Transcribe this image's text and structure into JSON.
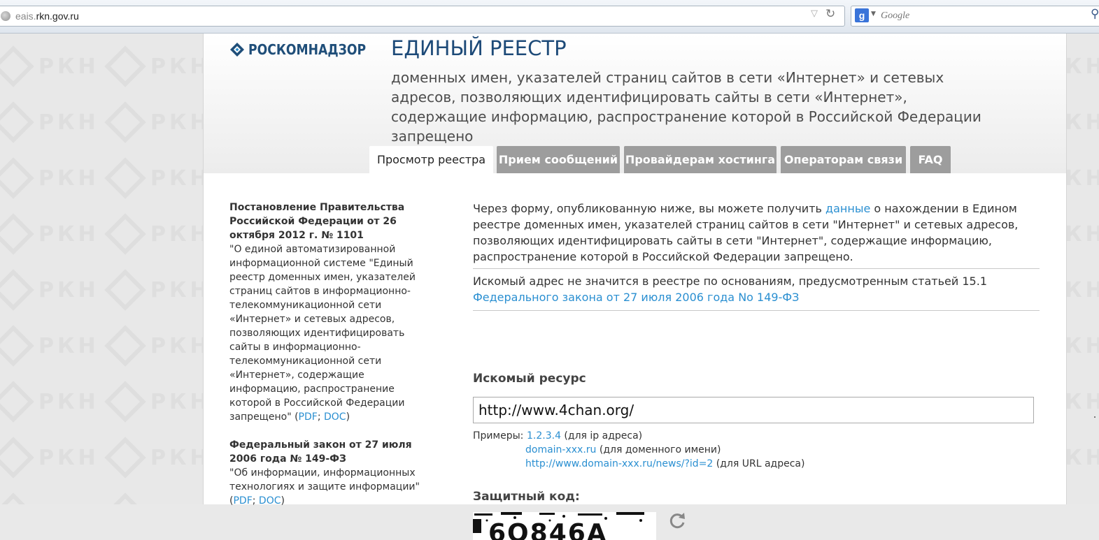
{
  "browser": {
    "url_dim": "eais.",
    "url_main": "rkn.gov.ru",
    "search_placeholder": "Google",
    "search_engine_letter": "g"
  },
  "watermark": {
    "text": "РКН"
  },
  "header": {
    "logo_text": "РОСКОМНАДЗОР",
    "title": "ЕДИНЫЙ РЕЕСТР",
    "subtitle": "доменных имен, указателей страниц сайтов в сети «Интернет» и сетевых адресов, позволяющих идентифицировать сайты в сети «Интернет», содержащие информацию, распространение которой в Российской Федерации запрещено"
  },
  "tabs": [
    {
      "label": "Просмотр реестра",
      "active": true
    },
    {
      "label": "Прием сообщений",
      "active": false
    },
    {
      "label": "Провайдерам хостинга",
      "active": false
    },
    {
      "label": "Операторам связи",
      "active": false
    },
    {
      "label": "FAQ",
      "active": false
    }
  ],
  "sidebar": {
    "docs": [
      {
        "title": "Постановление Правительства Российской Федерации от 26 октября 2012 г. № 1101",
        "desc": "\"О единой автоматизированной информационной системе \"Единый реестр доменных имен, указателей страниц сайтов в информационно-телекоммуникационной сети «Интернет» и сетевых адресов, позволяющих идентифицировать сайты в информационно-телекоммуникационной сети «Интернет», содержащие информацию, распространение которой в Российской Федерации запрещено\" (",
        "pdf": "PDF",
        "sep": "; ",
        "doc": "DOC",
        "close": ")"
      },
      {
        "title": "Федеральный закон от 27 июля 2006 года № 149-ФЗ",
        "desc": "\"Об информации, информационных технологиях и защите информации\" (",
        "pdf": "PDF",
        "sep": "; ",
        "doc": "DOC",
        "close": ")"
      }
    ]
  },
  "main": {
    "intro_before": "Через форму, опубликованную ниже, вы можете получить ",
    "intro_link": "данные",
    "intro_after": " о нахождении в Едином реестре доменных имен, указателей страниц сайтов в сети \"Интернет\" и сетевых адресов, позволяющих идентифицировать сайты в сети \"Интернет\", содержащие информацию, распространение которой в Российской Федерации запрещено.",
    "notice_text": "Искомый адрес не значится в реестре по основаниям, предусмотренным статьей 15.1 ",
    "notice_link": "Федерального закона от 27 июля 2006 года No 149-ФЗ",
    "resource_label": "Искомый ресурс",
    "resource_value": "http://www.4chan.org/",
    "examples_label": "Примеры:",
    "examples": [
      {
        "link": "1.2.3.4",
        "note": " (для ip адреса)"
      },
      {
        "link": "domain-xxx.ru",
        "note": " (для доменного имени)"
      },
      {
        "link": "http://www.domain-xxx.ru/news/?id=2",
        "note": " (для URL адреса)"
      }
    ],
    "captcha_label": "Защитный код:",
    "captcha_text": "6О846А"
  }
}
